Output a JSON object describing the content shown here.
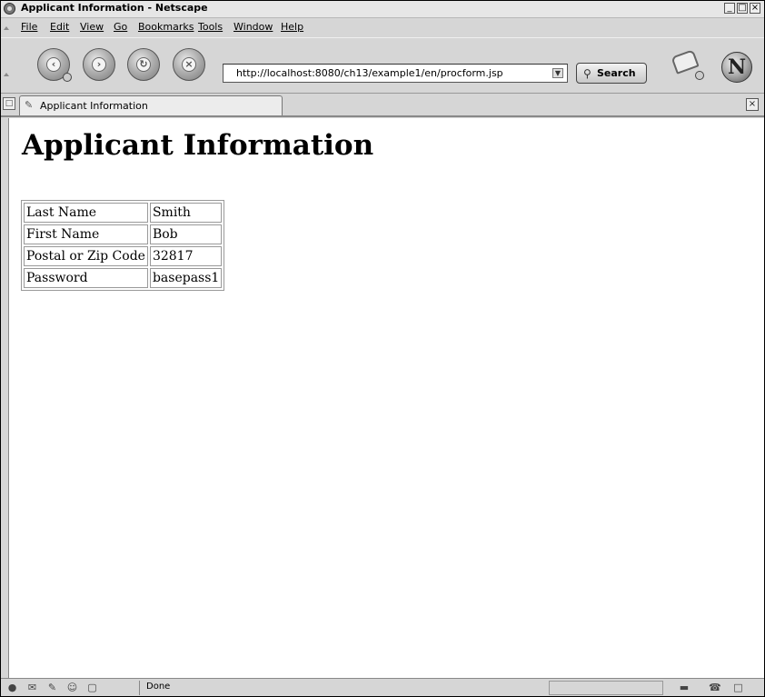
{
  "window": {
    "title": "Applicant Information - Netscape"
  },
  "window_controls": {
    "minimize": "_",
    "maximize": "□",
    "close": "×"
  },
  "menu": {
    "items": [
      {
        "label": "File"
      },
      {
        "label": "Edit"
      },
      {
        "label": "View"
      },
      {
        "label": "Go"
      },
      {
        "label": "Bookmarks"
      },
      {
        "label": "Tools"
      },
      {
        "label": "Window"
      },
      {
        "label": "Help"
      }
    ]
  },
  "toolbar": {
    "url": "http://localhost:8080/ch13/example1/en/procform.jsp",
    "search_label": "Search",
    "icons": [
      "back-icon",
      "forward-icon",
      "reload-icon",
      "stop-icon",
      "print-icon",
      "netscape-logo"
    ],
    "logo_letter": "N"
  },
  "tabs": [
    {
      "label": "Applicant Information"
    }
  ],
  "page": {
    "heading": "Applicant Information",
    "rows": [
      {
        "label": "Last Name",
        "value": "Smith"
      },
      {
        "label": "First Name",
        "value": "Bob"
      },
      {
        "label": "Postal or Zip Code",
        "value": "32817"
      },
      {
        "label": "Password",
        "value": "basepass1"
      }
    ]
  },
  "status": {
    "text": "Done",
    "icons": [
      "navigator-icon",
      "mail-icon",
      "composer-icon",
      "address-book-icon",
      "irc-icon",
      "connection-icon",
      "security-icon",
      "lock-icon"
    ]
  }
}
